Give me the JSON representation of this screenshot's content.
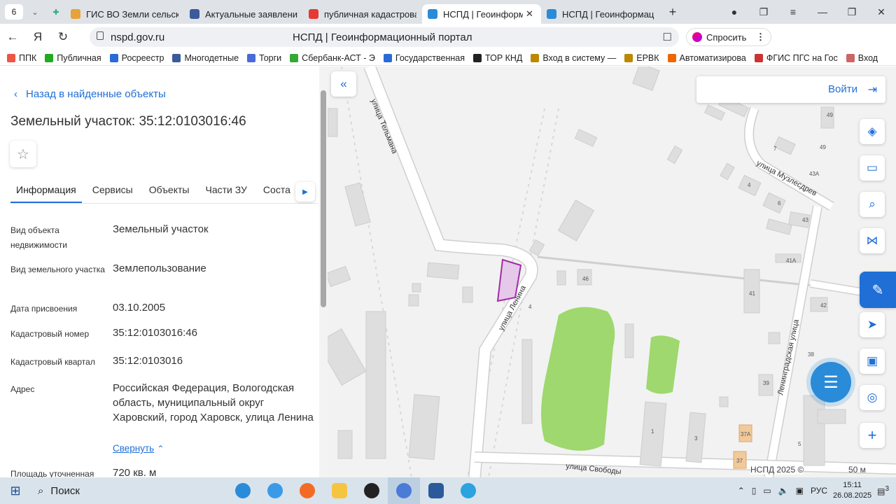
{
  "browser": {
    "tab_count": "6",
    "tabs": [
      {
        "title": "ГИС ВО Земли сельск",
        "color": "#e8a23a"
      },
      {
        "title": "Актуальные заявлени",
        "color": "#3a5a9a"
      },
      {
        "title": "публичная кадастрова",
        "color": "#e53935"
      },
      {
        "title": "НСПД | Геоинформа",
        "color": "#2a8bd8"
      },
      {
        "title": "НСПД | Геоинформаци",
        "color": "#2a8bd8"
      }
    ],
    "url_host": "nspd.gov.ru",
    "page_title": "НСПД | Геоинформационный портал",
    "ask_label": "Спросить",
    "bookmarks": [
      {
        "label": "ППК",
        "color": "#e54"
      },
      {
        "label": "Публичная",
        "color": "#2a2"
      },
      {
        "label": "Росреестр",
        "color": "#2a6ad6"
      },
      {
        "label": "Многодетные",
        "color": "#3a5a9a"
      },
      {
        "label": "Торги",
        "color": "#4a6ad6"
      },
      {
        "label": "Сбербанк-АСТ - Э",
        "color": "#3a3"
      },
      {
        "label": "Государственная",
        "color": "#2a6ad6"
      },
      {
        "label": "ТОР КНД",
        "color": "#222"
      },
      {
        "label": "Вход в систему —",
        "color": "#b80"
      },
      {
        "label": "ЕРВК",
        "color": "#b80"
      },
      {
        "label": "Автоматизирова",
        "color": "#e60"
      },
      {
        "label": "ФГИС ПГС на Гос",
        "color": "#c33"
      },
      {
        "label": "Вход",
        "color": "#c66"
      }
    ]
  },
  "panel": {
    "back_label": "Назад в найденные объекты",
    "title": "Земельный участок: 35:12:0103016:46",
    "tabs": [
      "Информация",
      "Сервисы",
      "Объекты",
      "Части ЗУ",
      "Соста"
    ],
    "fields": [
      {
        "label": "Вид объекта недвижимости",
        "value": "Земельный участок"
      },
      {
        "label": "Вид земельного участка",
        "value": "Землепользование"
      },
      {
        "label": "Дата присвоения",
        "value": "03.10.2005"
      },
      {
        "label": "Кадастровый номер",
        "value": "35:12:0103016:46"
      },
      {
        "label": "Кадастровый квартал",
        "value": "35:12:0103016"
      },
      {
        "label": "Адрес",
        "value": "Российская Федерация, Вологодская область, муниципальный округ Харовский, город Харовск, улица Ленина"
      },
      {
        "label": "Площадь уточненная",
        "value": "720 кв. м"
      }
    ],
    "collapse_label": "Свернуть"
  },
  "map": {
    "login_label": "Войти",
    "streets": [
      "улица Тельмана",
      "улица Ленина",
      "улица Музлесдрев",
      "Ленинградская улица",
      "улица Свободы"
    ],
    "house_numbers": [
      "49",
      "7",
      "49",
      "4",
      "43А",
      "6",
      "43",
      "41А",
      "41",
      "42",
      "46",
      "4",
      "38",
      "39",
      "1",
      "3",
      "37А",
      "37",
      "5"
    ],
    "attribution": "НСПД 2025 ©",
    "scale": "50 м"
  },
  "taskbar": {
    "search_label": "Поиск",
    "lang": "РУС",
    "time": "15:11",
    "date": "26.08.2025",
    "notif_count": "3"
  }
}
